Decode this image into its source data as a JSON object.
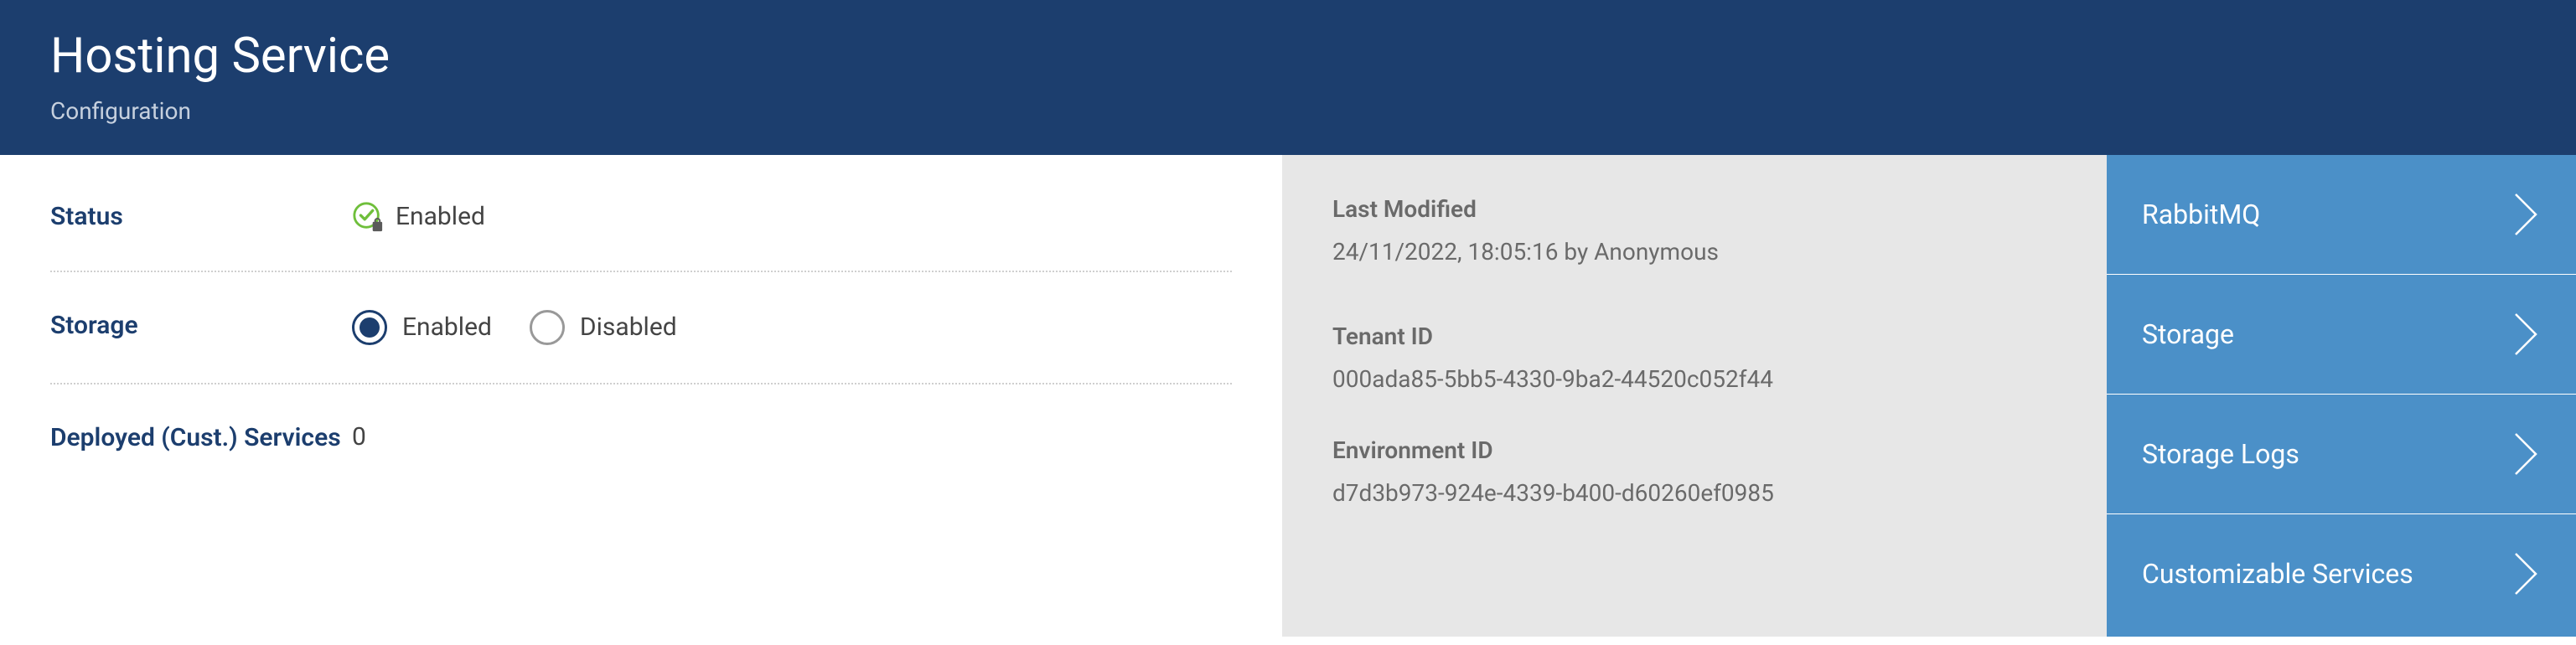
{
  "header": {
    "title": "Hosting Service",
    "subtitle": "Configuration"
  },
  "fields": {
    "status": {
      "label": "Status",
      "value": "Enabled"
    },
    "storage": {
      "label": "Storage",
      "options": {
        "enabled": "Enabled",
        "disabled": "Disabled"
      },
      "selected": "enabled"
    },
    "deployed": {
      "label": "Deployed (Cust.) Services",
      "value": "0"
    }
  },
  "info": {
    "last_modified": {
      "label": "Last Modified",
      "value": "24/11/2022, 18:05:16 by Anonymous"
    },
    "tenant_id": {
      "label": "Tenant ID",
      "value": "000ada85-5bb5-4330-9ba2-44520c052f44"
    },
    "environment_id": {
      "label": "Environment ID",
      "value": "d7d3b973-924e-4339-b400-d60260ef0985"
    }
  },
  "nav": {
    "items": [
      {
        "label": "RabbitMQ"
      },
      {
        "label": "Storage"
      },
      {
        "label": "Storage Logs"
      },
      {
        "label": "Customizable Services"
      }
    ]
  },
  "colors": {
    "header_bg": "#1c3e6e",
    "nav_bg": "#4b90c8",
    "info_bg": "#e7e7e7",
    "success": "#6fbf3b"
  }
}
